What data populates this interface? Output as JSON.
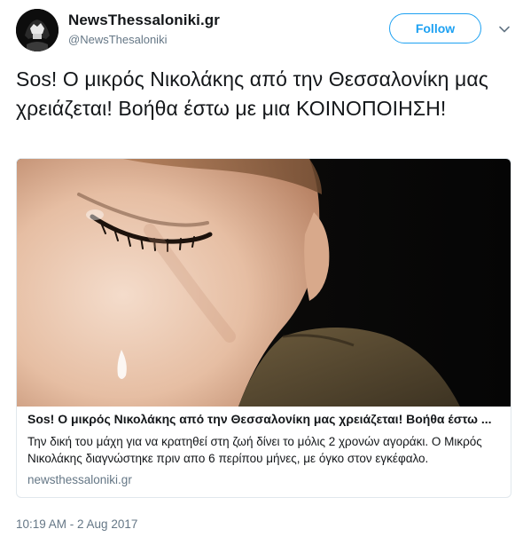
{
  "author": {
    "display_name": "NewsThessaloniki.gr",
    "handle": "@NewsThesaloniki"
  },
  "actions": {
    "follow_label": "Follow"
  },
  "tweet": {
    "text": "Sos! Ο μικρός Νικολάκης από την Θεσσαλονίκη μας χρειάζεται! Βοήθα έστω με μια ΚΟΙΝΟΠΟΙΗΣΗ!",
    "timestamp": "10:19 AM - 2 Aug 2017"
  },
  "card": {
    "title": "Sos! Ο μικρός Νικολάκης από την Θεσσαλονίκη μας χρειάζεται! Βοήθα έστω ...",
    "description": "Την δική του μάχη για να κρατηθεί στη ζωή δίνει το μόλις 2 χρονών αγοράκι. Ο Μικρός Νικολάκης διαγνώστηκε πριν απο 6 περίπου μήνες, με όγκο στον εγκέφαλο.",
    "domain": "newsthessaloniki.gr"
  },
  "colors": {
    "accent": "#1da1f2",
    "secondary_text": "#657786",
    "border": "#e1e8ed"
  },
  "icons": {
    "caret": "chevron-down-icon",
    "avatar": "avatar"
  }
}
